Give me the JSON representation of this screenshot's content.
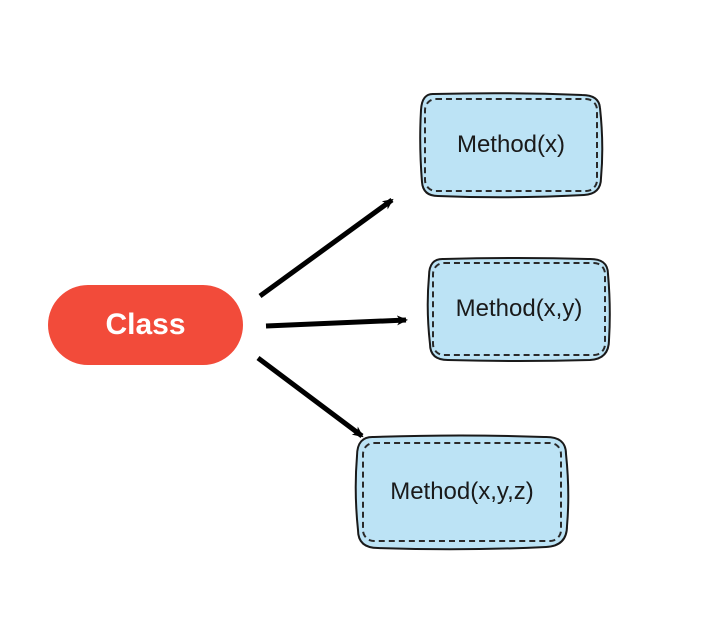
{
  "diagram": {
    "class_label": "Class",
    "methods": [
      {
        "label": "Method(x)"
      },
      {
        "label": "Method(x,y)"
      },
      {
        "label": "Method(x,y,z)"
      }
    ],
    "colors": {
      "class_fill": "#f24b3a",
      "class_text": "#ffffff",
      "method_fill": "#bce3f5",
      "outline": "#1a1a1a"
    }
  }
}
